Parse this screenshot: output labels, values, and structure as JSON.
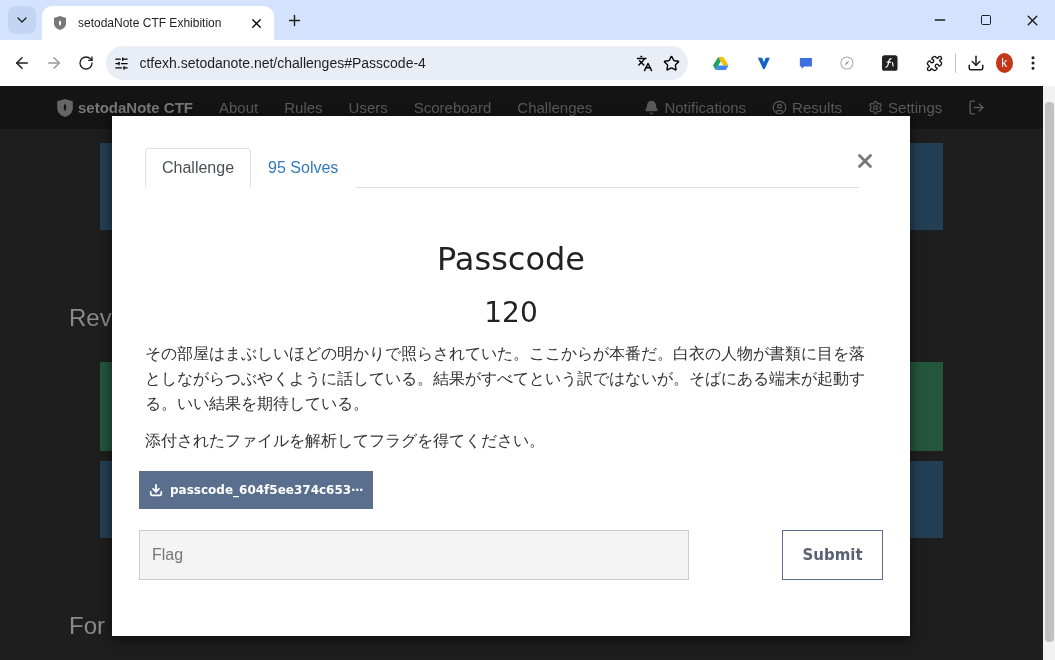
{
  "browser": {
    "tab_title": "setodaNote CTF Exhibition",
    "url": "ctfexh.setodanote.net/challenges#Passcode-4",
    "avatar": "k"
  },
  "navbar": {
    "brand": "setodaNote CTF",
    "links": [
      "About",
      "Rules",
      "Users",
      "Scoreboard",
      "Challenges"
    ],
    "right_links": [
      {
        "kind": "bell",
        "label": "Notifications"
      },
      {
        "kind": "user",
        "label": "Results"
      },
      {
        "kind": "gear",
        "label": "Settings"
      },
      {
        "kind": "logout"
      }
    ]
  },
  "page": {
    "headings": [
      "Rev",
      "For"
    ]
  },
  "modal": {
    "tabs": [
      {
        "label": "Challenge",
        "selected": true
      },
      {
        "label": "95 Solves",
        "selected": false
      }
    ],
    "title": "Passcode",
    "value": "120",
    "description": [
      "その部屋はまぶしいほどの明かりで照らされていた。ここからが本番だ。白衣の人物が書類に目を落としながらつぶやくように話している。結果がすべてという訳ではないが。そばにある端末が起動する。いい結果を期待している。",
      "添付されたファイルを解析してフラグを得てください。"
    ],
    "file": "passcode_604f5ee374c653⋯",
    "flag_placeholder": "Flag",
    "submit": "Submit"
  }
}
